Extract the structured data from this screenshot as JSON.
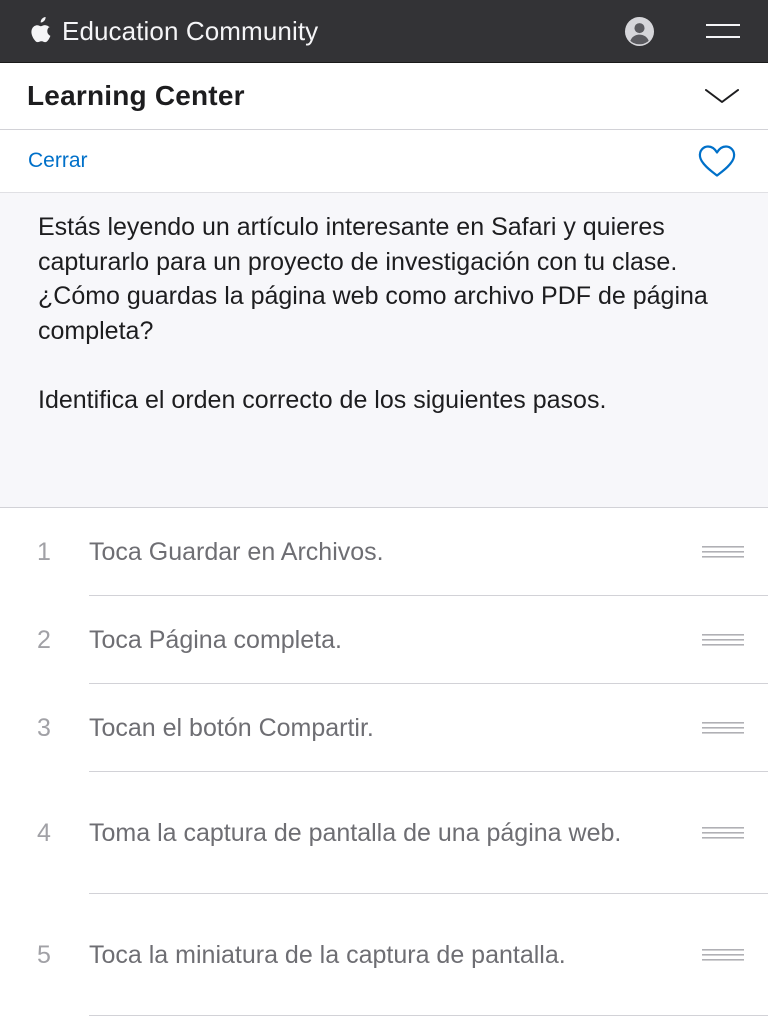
{
  "global_nav": {
    "brand_label": "Education Community",
    "icons": {
      "logo": "apple-logo-icon",
      "account": "account-icon",
      "menu": "hamburger-menu-icon"
    }
  },
  "local_nav": {
    "title": "Learning Center",
    "toggle_icon": "chevron-down-icon"
  },
  "action_bar": {
    "close_label": "Cerrar",
    "favorite_icon": "heart-outline-icon"
  },
  "question": {
    "prompt": "Estás leyendo un artículo interesante en Safari y quieres capturarlo para un proyecto de investigación con tu clase. ¿Cómo guardas la página web como archivo PDF de página completa?",
    "instruction": "Identifica el orden correcto de los siguientes pasos."
  },
  "steps": [
    {
      "number": "1",
      "text": "Toca Guardar en Archivos."
    },
    {
      "number": "2",
      "text": "Toca Página completa."
    },
    {
      "number": "3",
      "text": "Tocan el botón Compartir."
    },
    {
      "number": "4",
      "text": "Toma la captura de pantalla de una página web."
    },
    {
      "number": "5",
      "text": "Toca la miniatura de la captura de pantalla."
    }
  ],
  "colors": {
    "nav_background": "#333336",
    "link_blue": "#0070c9",
    "panel_background": "#f7f7fa",
    "divider": "#d2d2d7",
    "step_text": "#6e6e73",
    "step_number": "#a1a1a6"
  }
}
